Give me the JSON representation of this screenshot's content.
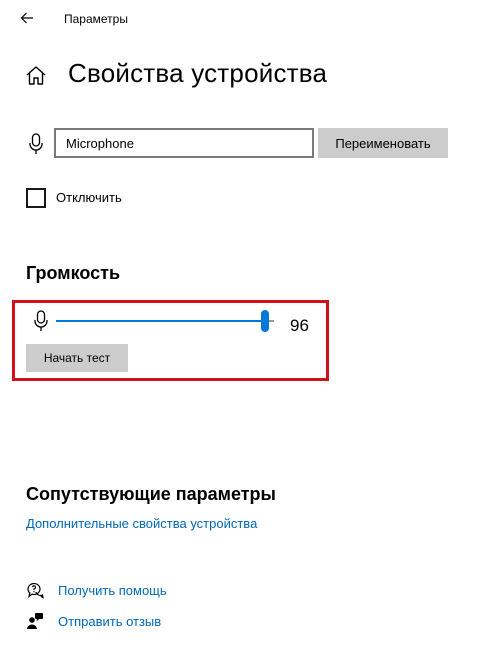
{
  "window": {
    "title": "Параметры"
  },
  "page": {
    "title": "Свойства устройства"
  },
  "device": {
    "name_value": "Microphone",
    "rename_label": "Переименовать",
    "disable_label": "Отключить",
    "disable_checked": false
  },
  "volume": {
    "heading": "Громкость",
    "value": 96,
    "value_text": "96",
    "min": 0,
    "max": 100,
    "test_button_label": "Начать тест"
  },
  "related": {
    "heading": "Сопутствующие параметры",
    "advanced_link": "Дополнительные свойства устройства"
  },
  "support": {
    "help_link": "Получить помощь",
    "feedback_link": "Отправить отзыв"
  },
  "colors": {
    "accent": "#0078d7",
    "link": "#0067b8",
    "highlight_border": "#d0101b",
    "button_bg": "#cccccc"
  },
  "icons": {
    "back": "back-arrow-icon",
    "home": "home-icon",
    "device": "microphone-icon",
    "volume": "microphone-icon",
    "help": "help-chat-icon",
    "feedback": "feedback-person-icon"
  }
}
